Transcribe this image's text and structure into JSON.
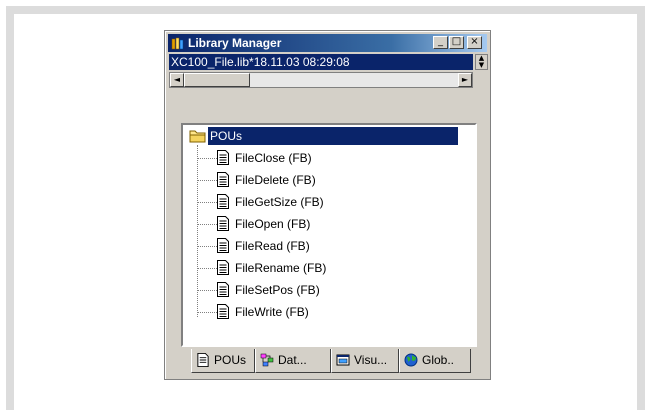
{
  "window": {
    "title": "Library Manager",
    "controls": {
      "minimize": "_",
      "maximize": "□",
      "close": "×"
    }
  },
  "library_path": "XC100_File.lib*18.11.03 08:29:08",
  "scroll": {
    "left_arrow": "◄",
    "right_arrow": "►",
    "spin_up": "▲",
    "spin_down": "▼"
  },
  "tree": {
    "root": "POUs",
    "items": [
      "FileClose (FB)",
      "FileDelete (FB)",
      "FileGetSize (FB)",
      "FileOpen (FB)",
      "FileRead (FB)",
      "FileRename (FB)",
      "FileSetPos (FB)",
      "FileWrite (FB)"
    ]
  },
  "tabs": [
    {
      "label": "POUs",
      "icon": "document-icon",
      "active": true
    },
    {
      "label": "Dat...",
      "icon": "datatype-icon",
      "active": false
    },
    {
      "label": "Visu...",
      "icon": "visualization-icon",
      "active": false
    },
    {
      "label": "Glob..",
      "icon": "globe-icon",
      "active": false
    }
  ],
  "colors": {
    "selection": "#0a246a",
    "face": "#d4d0c8",
    "title_start": "#0a246a",
    "title_end": "#a6caf0"
  }
}
